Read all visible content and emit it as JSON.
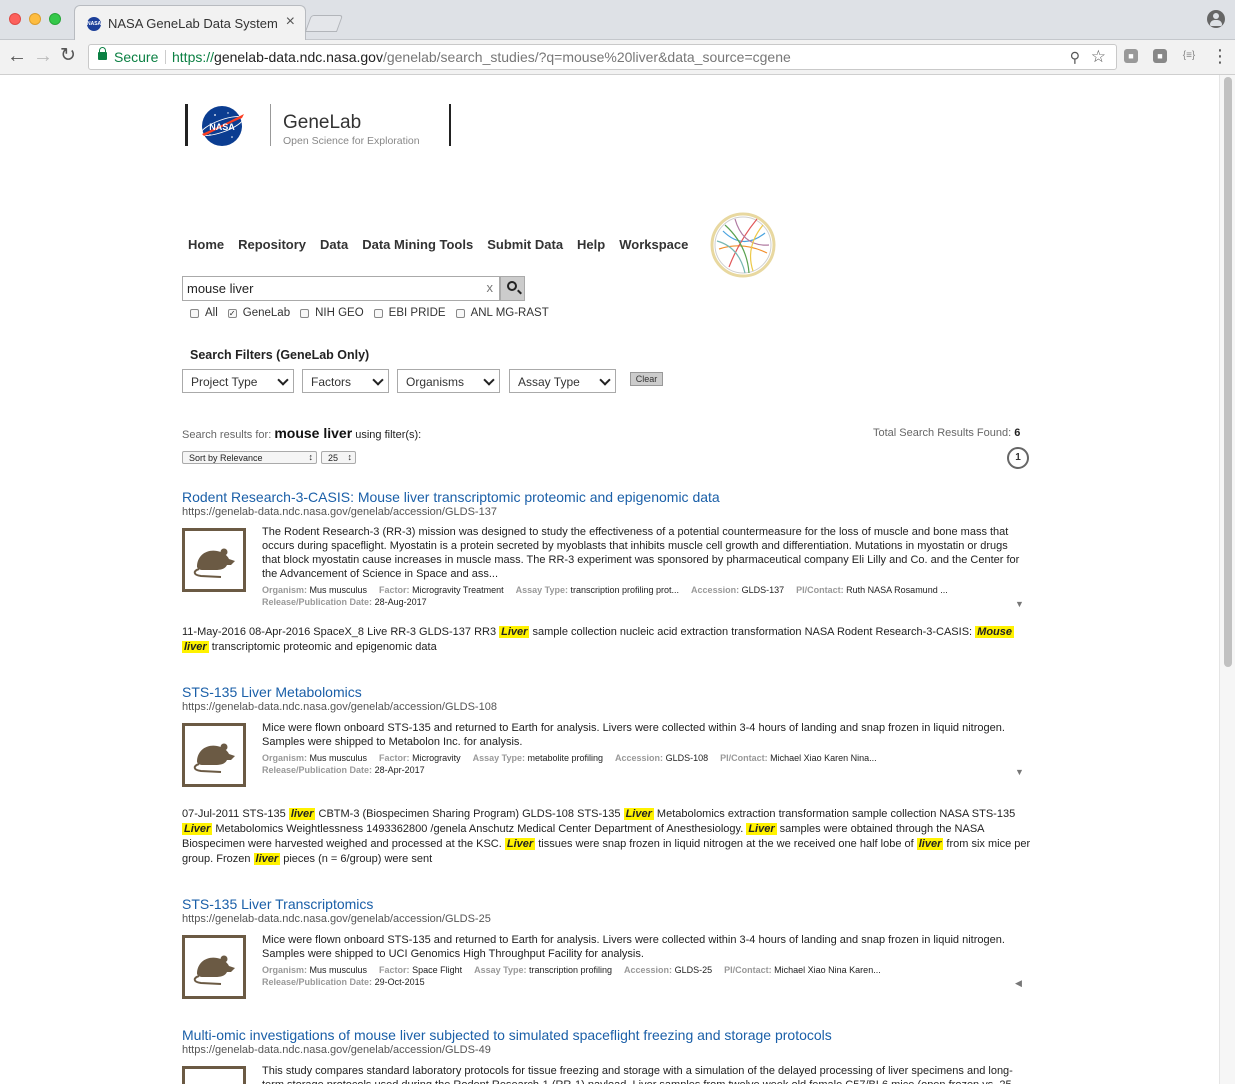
{
  "browser": {
    "tab_title": "NASA GeneLab Data Systems",
    "tab_close": "×",
    "secure_label": "Secure",
    "url_scheme": "https://",
    "url_host": "genelab-data.ndc.nasa.gov",
    "url_path": "/genelab/search_studies/?q=mouse%20liver&data_source=cgene",
    "ext3_label": "{≡}"
  },
  "logo": {
    "nasa_text": "NASA",
    "title": "GeneLab",
    "tagline": "Open Science for Exploration"
  },
  "nav": [
    "Home",
    "Repository",
    "Data",
    "Data Mining Tools",
    "Submit Data",
    "Help",
    "Workspace"
  ],
  "search": {
    "query": "mouse liver",
    "clear": "x",
    "sources": [
      {
        "label": "All",
        "checked": false
      },
      {
        "label": "GeneLab",
        "checked": true
      },
      {
        "label": "NIH GEO",
        "checked": false
      },
      {
        "label": "EBI PRIDE",
        "checked": false
      },
      {
        "label": "ANL MG-RAST",
        "checked": false
      }
    ]
  },
  "filters": {
    "heading": "Search Filters (GeneLab Only)",
    "project_type": "Project Type",
    "factors": "Factors",
    "organisms": "Organisms",
    "assay_type": "Assay Type",
    "clear": "Clear"
  },
  "results_header": {
    "prefix": "Search results for:",
    "query": "mouse liver",
    "suffix": "using filter(s):",
    "total_label": "Total Search Results Found:",
    "total": "6",
    "sort": "Sort by Relevance",
    "per_page": "25",
    "page": "1"
  },
  "meta_labels": {
    "organism": "Organism:",
    "factor": "Factor:",
    "assay": "Assay Type:",
    "accession": "Accession:",
    "pi": "PI/Contact:",
    "release": "Release/Publication Date:"
  },
  "results": [
    {
      "title": "Rodent Research-3-CASIS: Mouse liver transcriptomic proteomic and epigenomic data",
      "url": "https://genelab-data.ndc.nasa.gov/genelab/accession/GLDS-137",
      "description": "The Rodent Research-3 (RR-3) mission was designed to study the effectiveness of a potential countermeasure for the loss of muscle and bone mass that occurs during spaceflight. Myostatin is a protein secreted by myoblasts that inhibits muscle cell growth and differentiation. Mutations in myostatin or drugs that block myostatin cause increases in muscle mass. The RR-3 experiment was sponsored by pharmaceutical company Eli Lilly and Co. and the Center for the Advancement of Science in Space and ass...",
      "organism": "Mus musculus",
      "factor": "Microgravity Treatment",
      "assay": "transcription profiling prot...",
      "accession": "GLDS-137",
      "pi": "Ruth NASA Rosamund ...",
      "release": "28-Aug-2017",
      "toggle": "▼",
      "snippet": [
        {
          "t": "11-May-2016 08-Apr-2016 SpaceX_8 Live RR-3 GLDS-137 RR3 "
        },
        {
          "t": "Liver",
          "hl": true
        },
        {
          "t": " sample collection nucleic acid extraction transformation NASA Rodent Research-3-CASIS: "
        },
        {
          "t": "Mouse",
          "hl": true
        },
        {
          "t": " "
        },
        {
          "t": "liver",
          "hl": true
        },
        {
          "t": " transcriptomic proteomic and epigenomic data"
        }
      ]
    },
    {
      "title": "STS-135 Liver Metabolomics",
      "url": "https://genelab-data.ndc.nasa.gov/genelab/accession/GLDS-108",
      "description": "Mice were flown onboard STS-135 and returned to Earth for analysis. Livers were collected within 3-4 hours of landing and snap frozen in liquid nitrogen. Samples were shipped to Metabolon Inc. for analysis.",
      "organism": "Mus musculus",
      "factor": "Microgravity",
      "assay": "metabolite profiling",
      "accession": "GLDS-108",
      "pi": "Michael Xiao Karen Nina...",
      "release": "28-Apr-2017",
      "toggle": "▼",
      "snippet": [
        {
          "t": "07-Jul-2011 STS-135 "
        },
        {
          "t": "liver",
          "hl": true
        },
        {
          "t": " CBTM-3 (Biospecimen Sharing Program) GLDS-108 STS-135 "
        },
        {
          "t": "Liver",
          "hl": true
        },
        {
          "t": " Metabolomics extraction transformation sample collection NASA STS-135 "
        },
        {
          "t": "Liver",
          "hl": true
        },
        {
          "t": " Metabolomics Weightlessness 1493362800 /genela Anschutz Medical Center Department of Anesthesiology. "
        },
        {
          "t": "Liver",
          "hl": true
        },
        {
          "t": " samples were obtained through the NASA Biospecimen were harvested weighed and processed at the KSC. "
        },
        {
          "t": "Liver",
          "hl": true
        },
        {
          "t": " tissues were snap frozen in liquid nitrogen at the we received one half lobe of "
        },
        {
          "t": "liver",
          "hl": true
        },
        {
          "t": " from six mice per group. Frozen "
        },
        {
          "t": "liver",
          "hl": true
        },
        {
          "t": " pieces (n = 6/group) were sent"
        }
      ]
    },
    {
      "title": "STS-135 Liver Transcriptomics",
      "url": "https://genelab-data.ndc.nasa.gov/genelab/accession/GLDS-25",
      "description": "Mice were flown onboard STS-135 and returned to Earth for analysis. Livers were collected within 3-4 hours of landing and snap frozen in liquid nitrogen. Samples were shipped to UCI Genomics High Throughput Facility for analysis.",
      "organism": "Mus musculus",
      "factor": "Space Flight",
      "assay": "transcription profiling",
      "accession": "GLDS-25",
      "pi": "Michael Xiao Nina Karen...",
      "release": "29-Oct-2015",
      "toggle": "◀"
    },
    {
      "title": "Multi-omic investigations of mouse liver subjected to simulated spaceflight freezing and storage protocols",
      "url": "https://genelab-data.ndc.nasa.gov/genelab/accession/GLDS-49",
      "description": "This study compares standard laboratory protocols for tissue freezing and storage with a simulation of the delayed processing of liver specimens and long-term storage protocols used during the Rodent Research-1 (RR-1) payload. Liver samples from twelve week old female C57/BL6 mice (open frozen vs. 25"
    }
  ],
  "colors": {
    "link": "#1a5fa8",
    "highlight": "#fff200",
    "thumb_border": "#6b5a44",
    "secure_green": "#0b8043"
  }
}
